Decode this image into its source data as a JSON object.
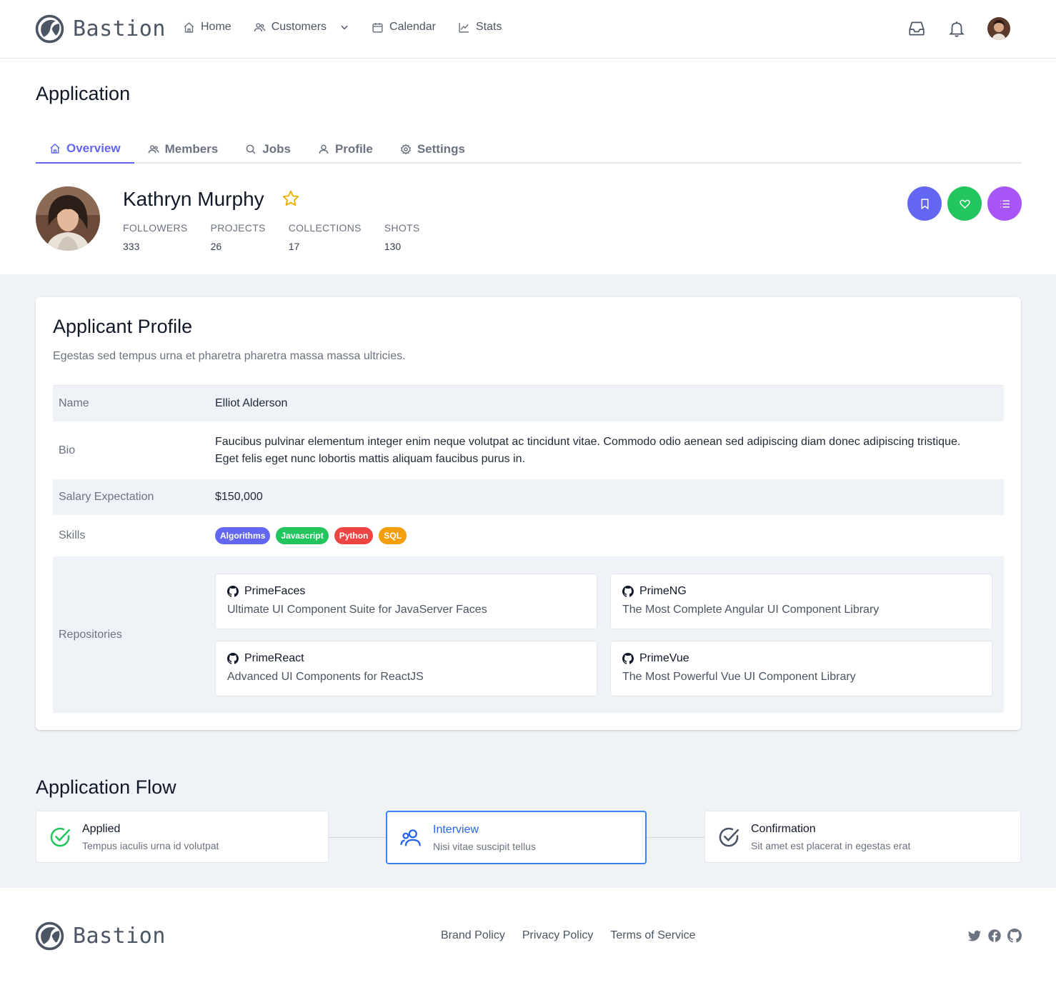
{
  "app": {
    "brand": "Bastion"
  },
  "nav": {
    "items": [
      {
        "label": "Home",
        "icon": "home-icon"
      },
      {
        "label": "Customers",
        "icon": "users-icon",
        "dropdown": true
      },
      {
        "label": "Calendar",
        "icon": "calendar-icon"
      },
      {
        "label": "Stats",
        "icon": "chart-icon"
      }
    ]
  },
  "page": {
    "title": "Application"
  },
  "tabs": [
    {
      "label": "Overview",
      "icon": "home-icon",
      "active": true
    },
    {
      "label": "Members",
      "icon": "users-icon"
    },
    {
      "label": "Jobs",
      "icon": "search-icon"
    },
    {
      "label": "Profile",
      "icon": "user-icon"
    },
    {
      "label": "Settings",
      "icon": "gear-icon"
    }
  ],
  "person": {
    "name": "Kathryn Murphy",
    "stats": [
      {
        "label": "FOLLOWERS",
        "value": "333"
      },
      {
        "label": "PROJECTS",
        "value": "26"
      },
      {
        "label": "COLLECTIONS",
        "value": "17"
      },
      {
        "label": "SHOTS",
        "value": "130"
      }
    ]
  },
  "actions": [
    {
      "icon": "bookmark-icon",
      "color": "#6366f1"
    },
    {
      "icon": "heart-icon",
      "color": "#22c55e"
    },
    {
      "icon": "list-icon",
      "color": "#a855f7"
    }
  ],
  "applicant": {
    "title": "Applicant Profile",
    "subtitle": "Egestas sed tempus urna et pharetra pharetra massa massa ultricies.",
    "fields": {
      "name_label": "Name",
      "name_value": "Elliot Alderson",
      "bio_label": "Bio",
      "bio_value": "Faucibus pulvinar elementum integer enim neque volutpat ac tincidunt vitae. Commodo odio aenean sed adipiscing diam donec adipiscing tristique. Eget felis eget nunc lobortis mattis aliquam faucibus purus in.",
      "salary_label": "Salary Expectation",
      "salary_value": "$150,000",
      "skills_label": "Skills",
      "repos_label": "Repositories"
    },
    "skills": [
      {
        "label": "Algorithms",
        "color": "#6366f1"
      },
      {
        "label": "Javascript",
        "color": "#22c55e"
      },
      {
        "label": "Python",
        "color": "#ef4444"
      },
      {
        "label": "SQL",
        "color": "#f59e0b"
      }
    ],
    "repositories": [
      {
        "name": "PrimeFaces",
        "description": "Ultimate UI Component Suite for JavaServer Faces"
      },
      {
        "name": "PrimeNG",
        "description": "The Most Complete Angular UI Component Library"
      },
      {
        "name": "PrimeReact",
        "description": "Advanced UI Components for ReactJS"
      },
      {
        "name": "PrimeVue",
        "description": "The Most Powerful Vue UI Component Library"
      }
    ]
  },
  "flow": {
    "title": "Application Flow",
    "steps": [
      {
        "title": "Applied",
        "description": "Tempus iaculis urna id volutpat",
        "icon": "check-circle-icon",
        "status": "done"
      },
      {
        "title": "Interview",
        "description": "Nisi vitae suscipit tellus",
        "icon": "users-icon",
        "status": "active"
      },
      {
        "title": "Confirmation",
        "description": "Sit amet est placerat in egestas erat",
        "icon": "check-circle-icon",
        "status": "pending"
      }
    ]
  },
  "footer": {
    "brand": "Bastion",
    "links": [
      "Brand Policy",
      "Privacy Policy",
      "Terms of Service"
    ],
    "socials": [
      "twitter-icon",
      "facebook-icon",
      "github-icon"
    ]
  }
}
